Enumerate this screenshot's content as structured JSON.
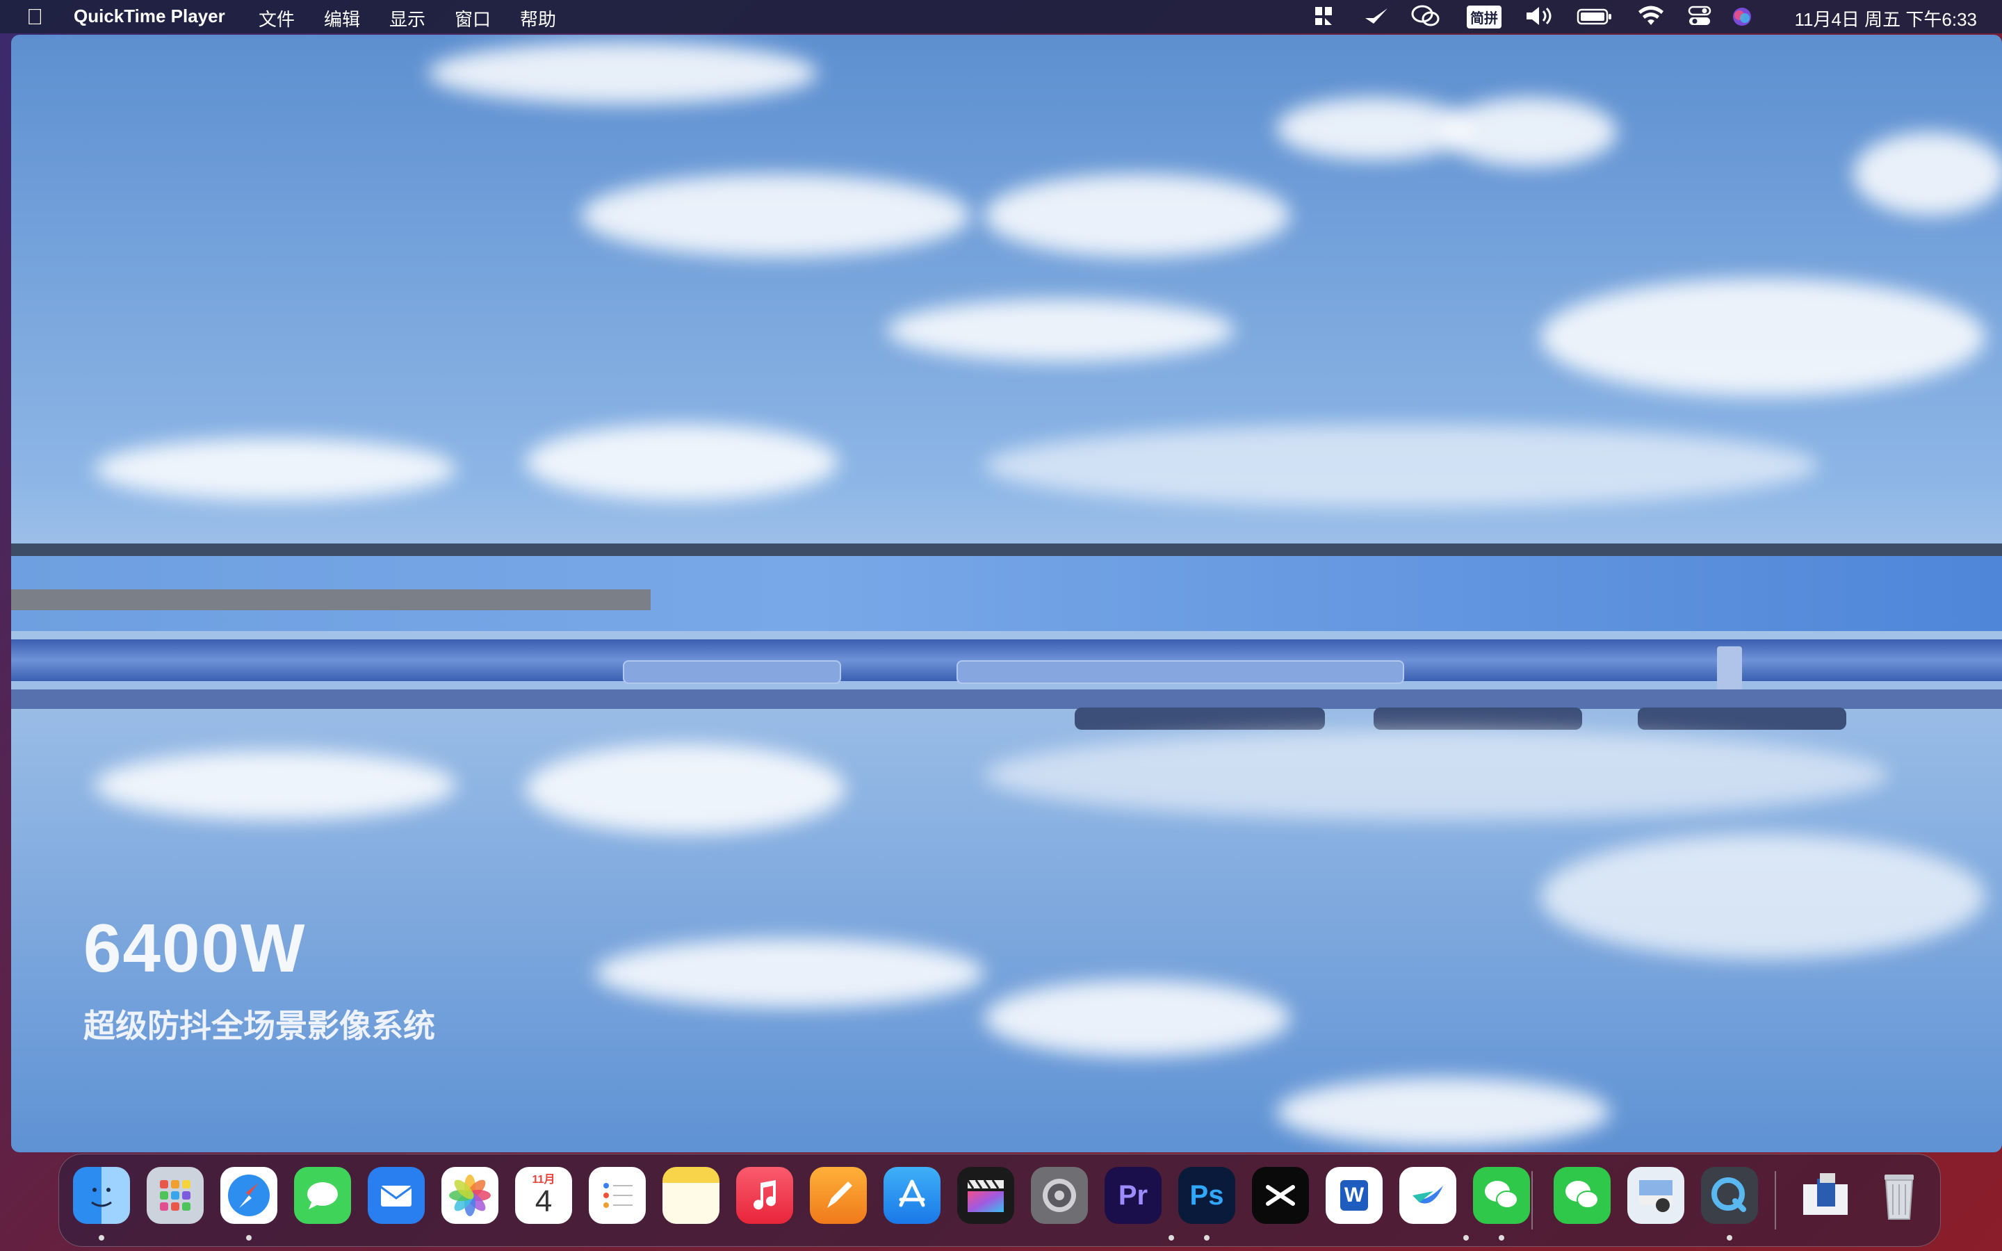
{
  "menubar": {
    "app_name": "QuickTime Player",
    "menus": [
      "文件",
      "编辑",
      "显示",
      "窗口",
      "帮助"
    ],
    "input_method": "简拼",
    "clock": "11月4日 周五 下午6:33"
  },
  "video": {
    "caption_title": "6400W",
    "caption_subtitle": "超级防抖全场景影像系统"
  },
  "dock": {
    "calendar_month": "11月",
    "calendar_day": "4",
    "apps": [
      "finder",
      "launchpad",
      "safari",
      "messages",
      "mail",
      "photos",
      "calendar",
      "reminders",
      "notes",
      "music",
      "pages",
      "app-store",
      "final-cut-pro",
      "system-preferences",
      "premiere-pro",
      "photoshop",
      "capcut",
      "word",
      "lark",
      "wechat",
      "wechat",
      "preview",
      "quicktime",
      "downloads",
      "trash"
    ],
    "labels": {
      "premiere": "Pr",
      "photoshop": "Ps",
      "word": "W"
    }
  },
  "colors": {
    "menubar_bg": "#1e2240",
    "sky_top": "#5d8fd0",
    "sky_mid": "#a8c6ea"
  }
}
